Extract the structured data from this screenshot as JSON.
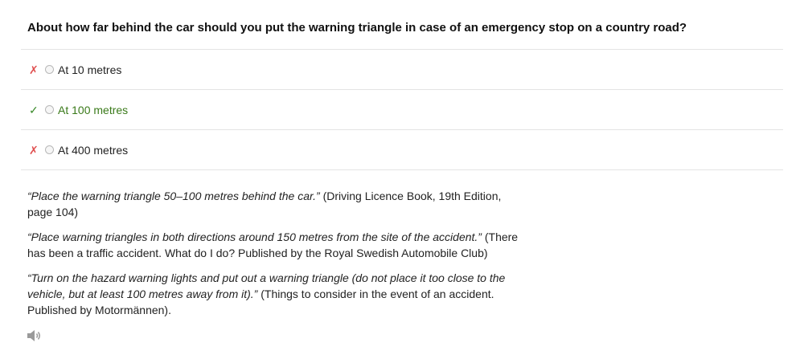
{
  "question": "About how far behind the car should you put the warning triangle in case of an emergency stop on a country road?",
  "answers": [
    {
      "mark": "✗",
      "label": "At 10 metres",
      "correct": false
    },
    {
      "mark": "✓",
      "label": "At 100 metres",
      "correct": true
    },
    {
      "mark": "✗",
      "label": "At 400 metres",
      "correct": false
    }
  ],
  "explanation": [
    {
      "quote": "“Place the warning triangle 50–100 metres behind the car.”",
      "source": " (Driving Licence Book, 19th Edition, page 104)"
    },
    {
      "quote": "“Place warning triangles in both directions around 150 metres from the site of the accident.”",
      "source": " (There has been a traffic accident. What do I do? Published by the Royal Swedish Automobile Club)"
    },
    {
      "quote": "“Turn on the hazard warning lights and put out a warning triangle (do not place it too close to the vehicle, but at least 100 metres away from it).”",
      "source": " (Things to consider in the event of an accident. Published by Motormännen)."
    }
  ],
  "icons": {
    "wrong": "cross-mark-icon",
    "correct": "check-mark-icon",
    "audio": "speaker-icon"
  },
  "colors": {
    "wrong_mark": "#e05050",
    "correct_mark": "#3a8a2a",
    "correct_text": "#3a7a1a"
  }
}
